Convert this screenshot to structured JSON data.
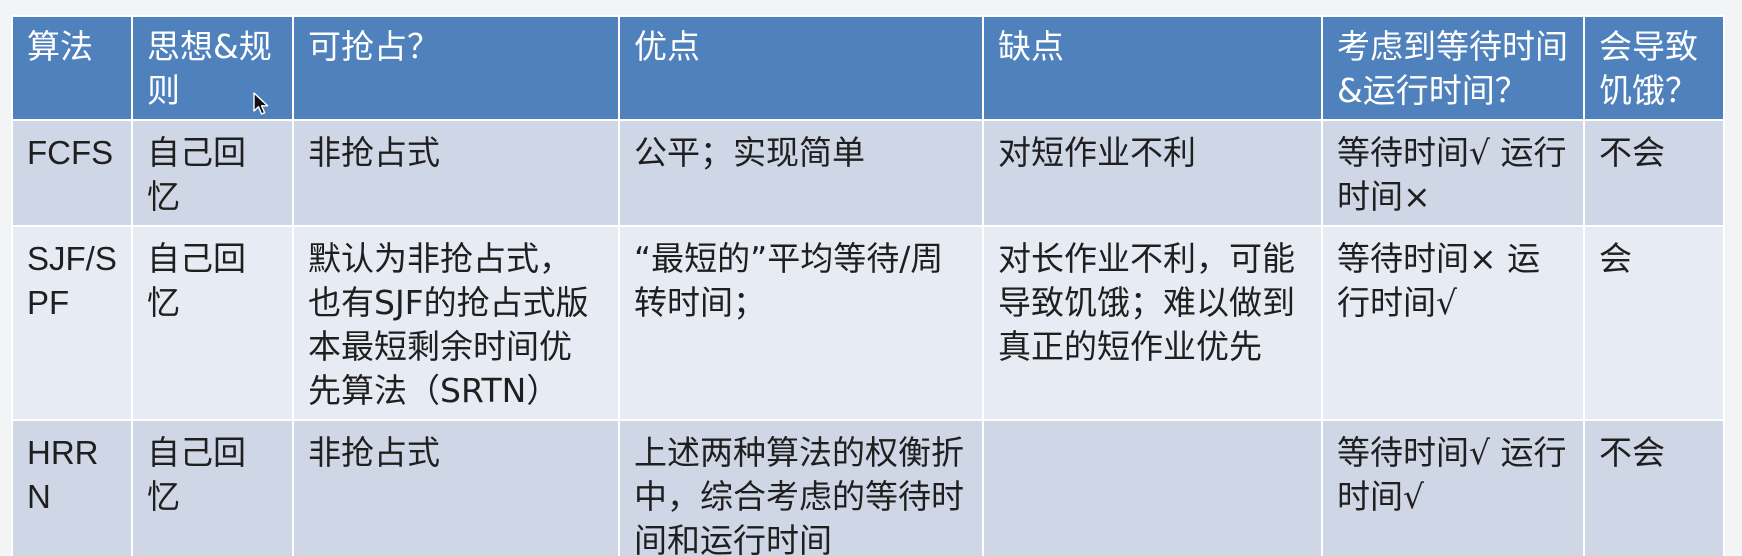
{
  "table": {
    "headers": [
      "算法",
      "思想&规则",
      "可抢占？",
      "优点",
      "缺点",
      "考虑到等待时间&运行时间？",
      "会导致饥饿？"
    ],
    "rows": [
      {
        "algorithm": "FCFS",
        "rule": "自己回忆",
        "preemptive": "非抢占式",
        "pros": "公平；实现简单",
        "cons": "对短作业不利",
        "wait_run": "等待时间√ 运行时间×",
        "starvation": "不会"
      },
      {
        "algorithm": "SJF/SPF",
        "rule": "自己回忆",
        "preemptive": "默认为非抢占式，也有SJF的抢占式版本最短剩余时间优先算法（SRTN）",
        "pros": "“最短的”平均等待/周转时间；",
        "cons": "对长作业不利，可能导致饥饿；难以做到真正的短作业优先",
        "wait_run": "等待时间× 运行时间√",
        "starvation": "会"
      },
      {
        "algorithm": "HRRN",
        "rule": "自己回忆",
        "preemptive": "非抢占式",
        "pros": "上述两种算法的权衡折中，综合考虑的等待时间和运行时间",
        "cons": "",
        "wait_run": "等待时间√ 运行时间√",
        "starvation": "不会"
      }
    ]
  },
  "colors": {
    "header_bg": "#4f81bd",
    "row_odd_bg": "#cfd7e6",
    "row_even_bg": "#e7ebf3",
    "header_text": "#ffffff",
    "body_text": "#1f1f1f"
  },
  "icons": {
    "cursor": "mouse-pointer-icon"
  }
}
